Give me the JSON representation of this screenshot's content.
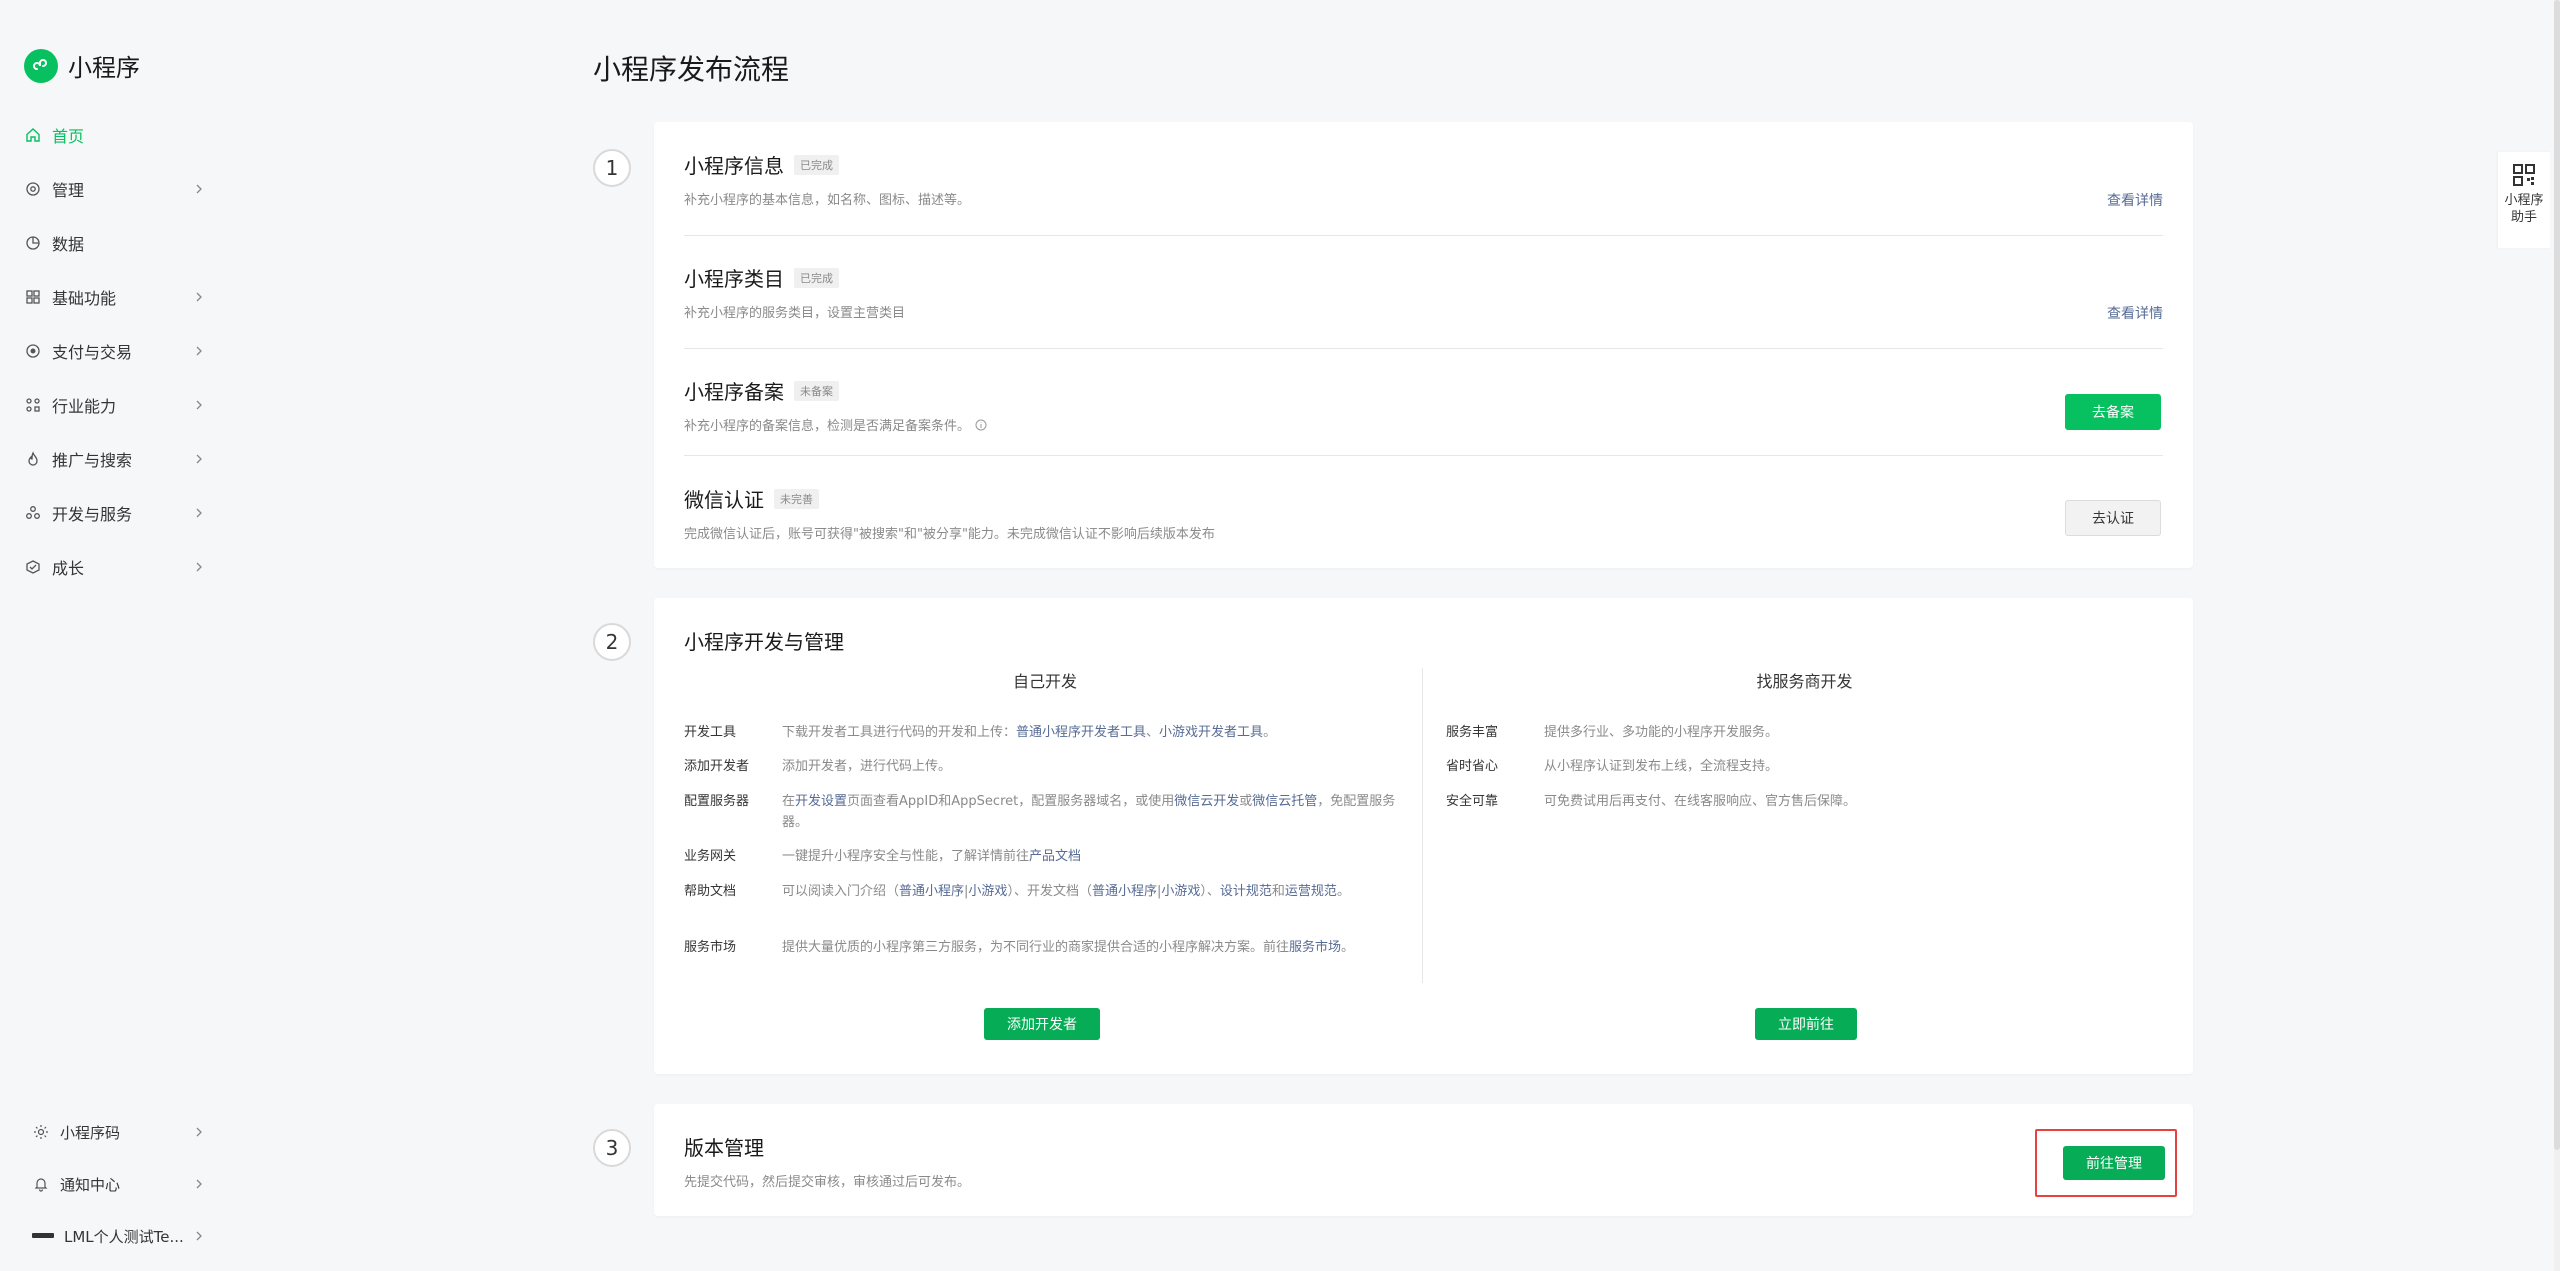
{
  "brand": {
    "name": "小程序"
  },
  "sidebar": {
    "items": [
      {
        "label": "首页",
        "icon": "home-icon",
        "active": true
      },
      {
        "label": "管理",
        "icon": "settings-icon"
      },
      {
        "label": "数据",
        "icon": "pie-chart-icon"
      },
      {
        "label": "基础功能",
        "icon": "grid-icon"
      },
      {
        "label": "支付与交易",
        "icon": "payment-icon"
      },
      {
        "label": "行业能力",
        "icon": "industry-icon"
      },
      {
        "label": "推广与搜索",
        "icon": "flame-icon"
      },
      {
        "label": "开发与服务",
        "icon": "dev-icon"
      },
      {
        "label": "成长",
        "icon": "growth-icon"
      }
    ],
    "bottom": [
      {
        "label": "小程序码",
        "icon": "sun-icon"
      },
      {
        "label": "通知中心",
        "icon": "bell-icon"
      },
      {
        "label": "LML个人测试Te...",
        "icon": "account-logo-icon"
      }
    ]
  },
  "page": {
    "title": "小程序发布流程"
  },
  "steps": {
    "one": "1",
    "two": "2",
    "three": "3"
  },
  "card1": {
    "rows": [
      {
        "title": "小程序信息",
        "tag": "已完成",
        "desc": "补充小程序的基本信息，如名称、图标、描述等。",
        "link": "查看详情"
      },
      {
        "title": "小程序类目",
        "tag": "已完成",
        "desc": "补充小程序的服务类目，设置主营类目",
        "link": "查看详情"
      },
      {
        "title": "小程序备案",
        "tag": "未备案",
        "desc": "补充小程序的备案信息，检测是否满足备案条件。",
        "button": "去备案"
      },
      {
        "title": "微信认证",
        "tag": "未完善",
        "desc": "完成微信认证后，账号可获得\"被搜索\"和\"被分享\"能力。未完成微信认证不影响后续版本发布",
        "button": "去认证"
      }
    ]
  },
  "card2": {
    "title": "小程序开发与管理",
    "self": {
      "heading": "自己开发",
      "items": [
        {
          "k": "开发工具",
          "v1": "下载开发者工具进行代码的开发和上传：",
          "l1": "普通小程序开发者工具",
          "v2": "、",
          "l2": "小游戏开发者工具",
          "v3": "。"
        },
        {
          "k": "添加开发者",
          "v1": "添加开发者，进行代码上传。"
        },
        {
          "k": "配置服务器",
          "v1": "在",
          "l1": "开发设置",
          "v2": "页面查看AppID和AppSecret，配置服务器域名，或使用",
          "l2": "微信云开发",
          "v3": "或",
          "l3": "微信云托管",
          "v4": "，免配置服务器。"
        },
        {
          "k": "业务网关",
          "v1": "一键提升小程序安全与性能，了解详情前往",
          "l1": "产品文档"
        },
        {
          "k": "帮助文档",
          "v1": "可以阅读入门介绍（",
          "l1": "普通小程序",
          "v2": "|",
          "l2": "小游戏",
          "v3": "）、开发文档（",
          "l3": "普通小程序",
          "v4": "|",
          "l4": "小游戏",
          "v5": "）、",
          "l5": "设计规范",
          "v6": "和",
          "l6": "运营规范",
          "v7": "。"
        },
        {
          "k": "服务市场",
          "v1": "提供大量优质的小程序第三方服务，为不同行业的商家提供合适的小程序解决方案。前往",
          "l1": "服务市场",
          "v2": "。"
        }
      ],
      "button": "添加开发者"
    },
    "vendor": {
      "heading": "找服务商开发",
      "items": [
        {
          "k": "服务丰富",
          "v": "提供多行业、多功能的小程序开发服务。"
        },
        {
          "k": "省时省心",
          "v": "从小程序认证到发布上线，全流程支持。"
        },
        {
          "k": "安全可靠",
          "v": "可免费试用后再支付、在线客服响应、官方售后保障。"
        }
      ],
      "button": "立即前往"
    }
  },
  "card3": {
    "title": "版本管理",
    "desc": "先提交代码，然后提交审核，审核通过后可发布。",
    "button": "前往管理"
  },
  "helper": {
    "label": "小程序助手",
    "icon": "qr-code-icon"
  },
  "colors": {
    "brand": "#07c160",
    "link": "#576b95",
    "highlight": "#e64340"
  }
}
